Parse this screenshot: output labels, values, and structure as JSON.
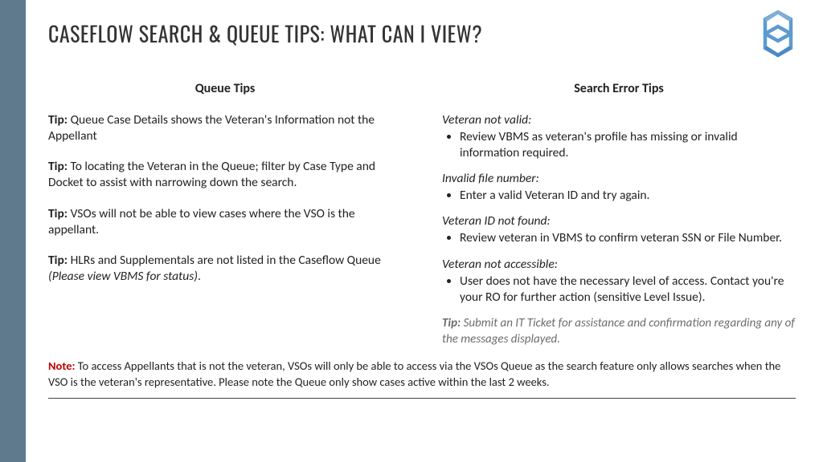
{
  "title": "CASEFLOW SEARCH & QUEUE TIPS: WHAT CAN I VIEW?",
  "left": {
    "header": "Queue Tips",
    "label": "Tip:",
    "tips": [
      {
        "text": " Queue Case Details shows the Veteran's Information not the Appellant"
      },
      {
        "text": "  To locating the Veteran in the Queue; filter by Case Type and Docket to assist with narrowing down the search."
      },
      {
        "text": " VSOs will not be able to view cases where the VSO is the appellant."
      },
      {
        "text": " HLRs and Supplementals are not listed in the Caseflow Queue ",
        "aside": "(Please view VBMS for status)",
        "trail": "."
      }
    ]
  },
  "right": {
    "header": "Search Error Tips",
    "errors": [
      {
        "heading": "Veteran not valid:",
        "item": "Review VBMS as veteran's profile has missing or invalid information required."
      },
      {
        "heading": "Invalid file number:",
        "item": "Enter a valid Veteran ID and try again."
      },
      {
        "heading": "Veteran ID not found:",
        "item": "Review veteran in VBMS to confirm veteran SSN or File Number."
      },
      {
        "heading": "Veteran not accessible:",
        "item": "User does not have the necessary level of access. Contact you're your RO for further action (sensitive Level Issue)."
      }
    ],
    "tipLabel": "Tip:",
    "tipText": " Submit an IT Ticket for assistance and confirmation regarding any of the messages displayed."
  },
  "note": {
    "label": "Note:",
    "text": " To access Appellants that is not the veteran, VSOs will only be able to access via the VSOs Queue as the search feature only allows searches when the VSO is the veteran's representative. Please note the Queue only show cases active within the last 2 weeks."
  }
}
